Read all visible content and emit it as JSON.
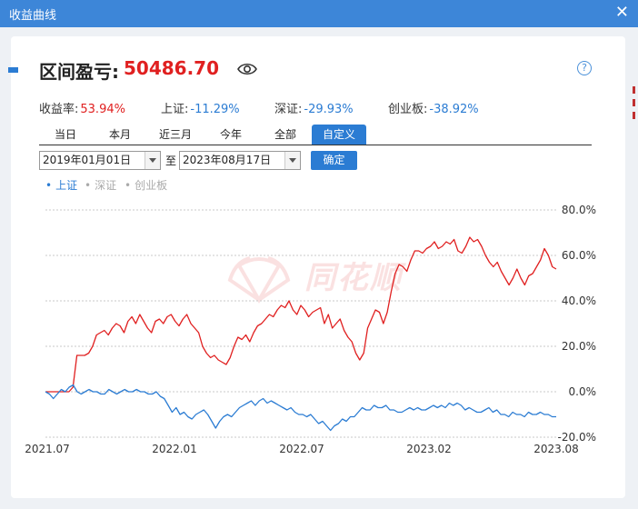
{
  "window": {
    "title": "收益曲线",
    "close_label": "✕"
  },
  "header": {
    "label": "区间盈亏:",
    "value": "50486.70",
    "eye_icon": "eye-icon",
    "help_label": "?"
  },
  "stats": [
    {
      "label": "收益率:",
      "value": "53.94%",
      "color": "#e02020"
    },
    {
      "label": "上证:",
      "value": "-11.29%",
      "color": "#2b7cd3"
    },
    {
      "label": "深证:",
      "value": "-29.93%",
      "color": "#2b7cd3"
    },
    {
      "label": "创业板:",
      "value": "-38.92%",
      "color": "#2b7cd3"
    }
  ],
  "tabs": [
    {
      "label": "当日",
      "active": false
    },
    {
      "label": "本月",
      "active": false
    },
    {
      "label": "近三月",
      "active": false
    },
    {
      "label": "今年",
      "active": false
    },
    {
      "label": "全部",
      "active": false
    },
    {
      "label": "自定义",
      "active": true
    }
  ],
  "date_range": {
    "start": "2019年01月01日",
    "to_label": "至",
    "end": "2023年08月17日",
    "confirm_label": "确定"
  },
  "legend": [
    {
      "label": "上证",
      "active": true
    },
    {
      "label": "深证",
      "active": false
    },
    {
      "label": "创业板",
      "active": false
    }
  ],
  "watermark": {
    "text": "同花顺"
  },
  "colors": {
    "accent": "#2b7cd3",
    "profit": "#e02020",
    "index": "#2b7cd3",
    "titlebar": "#3d86d8"
  },
  "chart_data": {
    "type": "line",
    "x_ticks": [
      "2021.07",
      "2022.01",
      "2022.07",
      "2023.02",
      "2023.08"
    ],
    "y_ticks": [
      "80.0%",
      "60.0%",
      "40.0%",
      "20.0%",
      "0.0%",
      "-20.0%"
    ],
    "ylim": [
      -20,
      80
    ],
    "grid": true,
    "series": [
      {
        "key": "profit",
        "color": "#e02020",
        "values": [
          0,
          0,
          0,
          0,
          0,
          0,
          0,
          2,
          16,
          16,
          16,
          17,
          20,
          25,
          26,
          27,
          25,
          28,
          30,
          29,
          26,
          31,
          33,
          30,
          34,
          31,
          28,
          26,
          31,
          32,
          30,
          33,
          34,
          31,
          29,
          32,
          34,
          30,
          28,
          26,
          20,
          17,
          15,
          16,
          14,
          13,
          12,
          15,
          20,
          24,
          23,
          25,
          22,
          26,
          29,
          30,
          32,
          34,
          33,
          36,
          38,
          37,
          40,
          36,
          34,
          38,
          36,
          33,
          35,
          36,
          37,
          30,
          34,
          28,
          30,
          32,
          27,
          24,
          22,
          17,
          14,
          17,
          28,
          32,
          36,
          35,
          30,
          35,
          44,
          52,
          56,
          55,
          53,
          58,
          62,
          62,
          61,
          63,
          64,
          66,
          63,
          64,
          66,
          65,
          67,
          62,
          61,
          64,
          68,
          66,
          67,
          64,
          60,
          57,
          55,
          57,
          53,
          50,
          47,
          50,
          54,
          50,
          47,
          51,
          52,
          55,
          58,
          63,
          60,
          55,
          54
        ]
      },
      {
        "key": "index",
        "color": "#2b7cd3",
        "values": [
          0,
          -1,
          -3,
          -1,
          1,
          0,
          2,
          3,
          0,
          -1,
          0,
          1,
          0,
          0,
          -1,
          -1,
          1,
          0,
          -1,
          0,
          1,
          0,
          0,
          1,
          0,
          0,
          -1,
          -1,
          0,
          -2,
          -3,
          -6,
          -9,
          -7,
          -10,
          -9,
          -11,
          -12,
          -10,
          -9,
          -8,
          -10,
          -13,
          -16,
          -13,
          -11,
          -10,
          -11,
          -9,
          -7,
          -6,
          -5,
          -4,
          -6,
          -4,
          -3,
          -5,
          -4,
          -5,
          -6,
          -7,
          -8,
          -7,
          -9,
          -10,
          -10,
          -11,
          -10,
          -12,
          -14,
          -13,
          -15,
          -17,
          -15,
          -14,
          -12,
          -13,
          -11,
          -11,
          -9,
          -7,
          -8,
          -8,
          -6,
          -7,
          -7,
          -6,
          -8,
          -8,
          -9,
          -9,
          -8,
          -7,
          -8,
          -7,
          -8,
          -8,
          -7,
          -6,
          -7,
          -6,
          -7,
          -5,
          -6,
          -5,
          -6,
          -8,
          -7,
          -8,
          -9,
          -9,
          -8,
          -7,
          -9,
          -8,
          -10,
          -10,
          -11,
          -9,
          -10,
          -10,
          -11,
          -9,
          -10,
          -10,
          -9,
          -10,
          -10,
          -11,
          -11
        ]
      }
    ]
  }
}
